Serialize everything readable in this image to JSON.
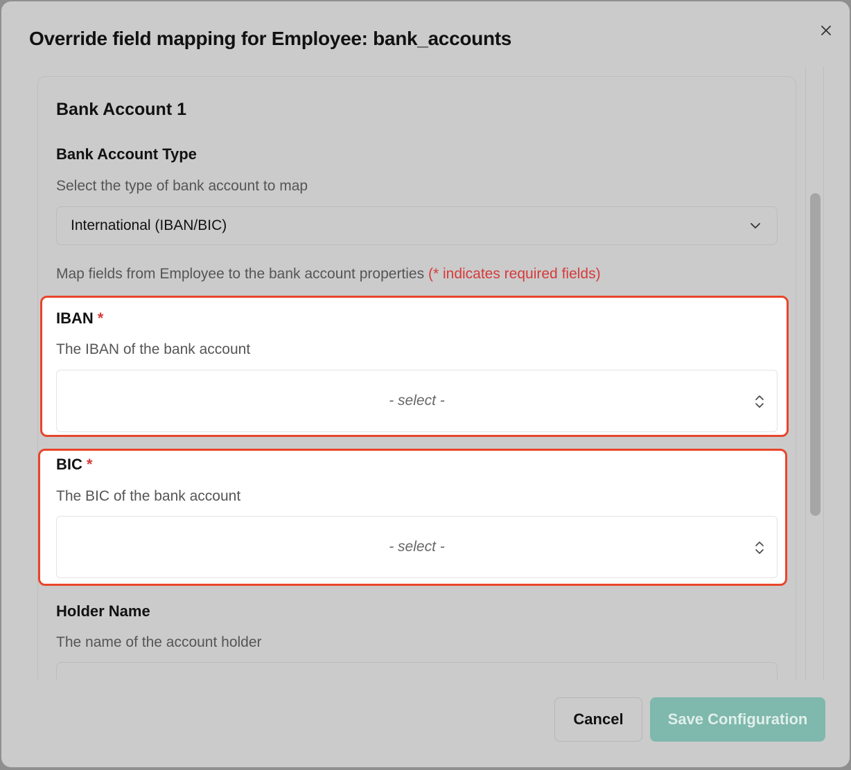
{
  "dialog": {
    "title": "Override field mapping for Employee: bank_accounts",
    "close_icon": "close-icon"
  },
  "card": {
    "title": "Bank Account 1",
    "account_type": {
      "label": "Bank Account Type",
      "description": "Select the type of bank account to map",
      "selected": "International (IBAN/BIC)"
    },
    "map_info": {
      "text": "Map fields from Employee to the bank account properties",
      "required_note": "(* indicates required fields)"
    },
    "fields": {
      "iban": {
        "label": "IBAN",
        "required_marker": "*",
        "description": "The IBAN of the bank account",
        "placeholder": "- select -"
      },
      "bic": {
        "label": "BIC",
        "required_marker": "*",
        "description": "The BIC of the bank account",
        "placeholder": "- select -"
      },
      "holder_name": {
        "label": "Holder Name",
        "description": "The name of the account holder"
      }
    }
  },
  "footer": {
    "cancel_label": "Cancel",
    "save_label": "Save Configuration"
  },
  "colors": {
    "highlight": "#e8452a",
    "required": "#d63a3a",
    "save_button": "#7fb8ac"
  }
}
